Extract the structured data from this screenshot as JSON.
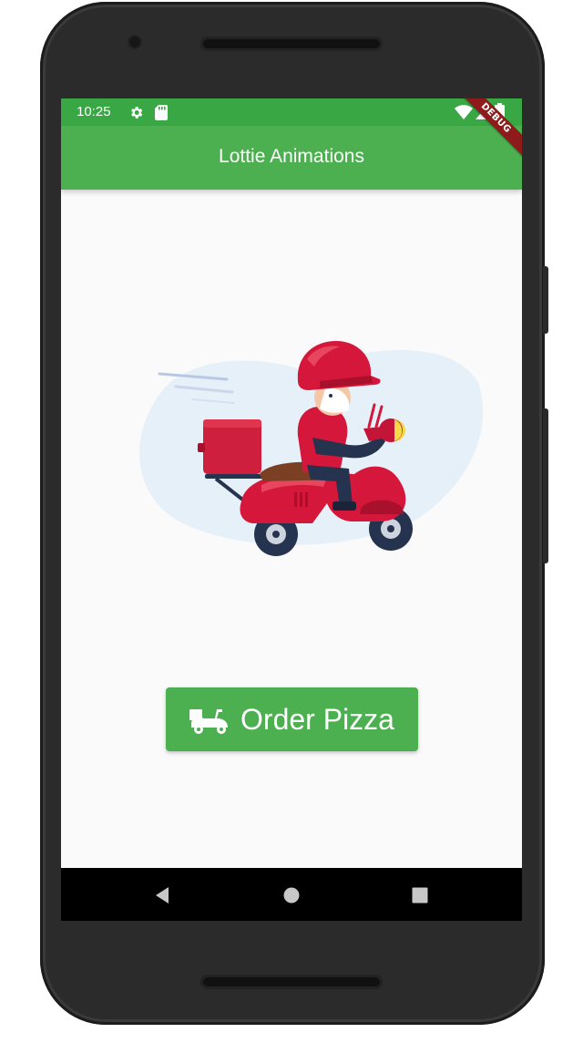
{
  "status_bar": {
    "time": "10:25",
    "icons": [
      "settings-gear-icon",
      "sd-card-icon",
      "wifi-icon",
      "cell-signal-icon",
      "battery-icon"
    ]
  },
  "debug_banner": {
    "label": "DEBUG"
  },
  "app_bar": {
    "title": "Lottie Animations"
  },
  "illustration": {
    "icon": "delivery-scooter-rider-illustration"
  },
  "order_button": {
    "label": "Order Pizza",
    "icon": "delivery-scooter-icon"
  },
  "nav_bar": {
    "icons": [
      "back-triangle-icon",
      "home-circle-icon",
      "recents-square-icon"
    ]
  },
  "colors": {
    "status_bar": "#3aa745",
    "app_bar": "#4cb050",
    "button": "#4cb050",
    "background": "#fafafa",
    "scooter_red": "#d4173b",
    "debug_banner": "#8e1b1b"
  }
}
